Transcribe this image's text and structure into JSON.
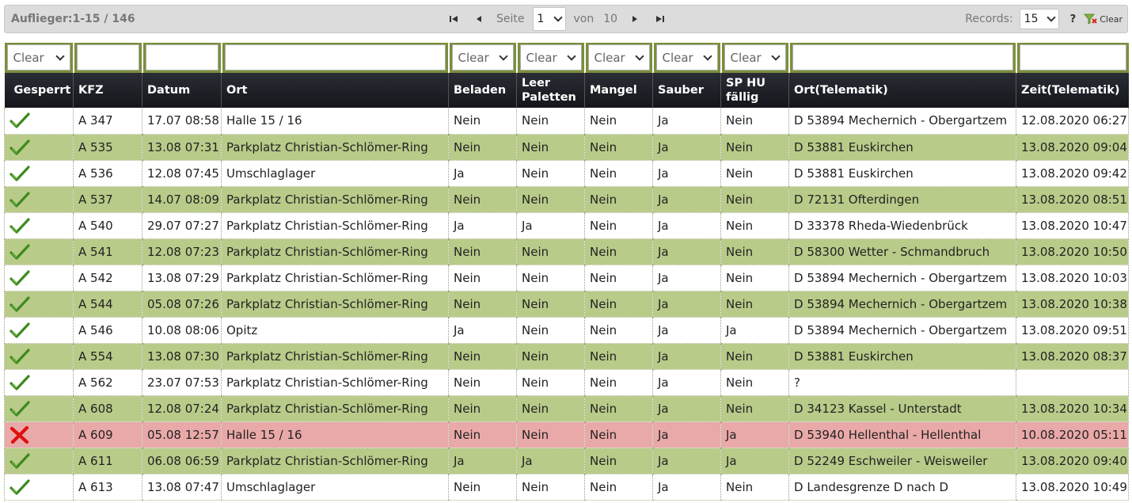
{
  "toolbar": {
    "title": "Auflieger:1-15 / 146",
    "page_label": "Seite",
    "page_value": "1",
    "of_label": "von",
    "total_pages": "10",
    "records_label": "Records:",
    "records_value": "15",
    "help_label": "?",
    "clear_label": "Clear"
  },
  "filters": [
    {
      "type": "select",
      "value": "Clear"
    },
    {
      "type": "input",
      "value": ""
    },
    {
      "type": "input",
      "value": ""
    },
    {
      "type": "input",
      "value": ""
    },
    {
      "type": "select",
      "value": "Clear"
    },
    {
      "type": "select",
      "value": "Clear"
    },
    {
      "type": "select",
      "value": "Clear"
    },
    {
      "type": "select",
      "value": "Clear"
    },
    {
      "type": "select",
      "value": "Clear"
    },
    {
      "type": "input",
      "value": ""
    },
    {
      "type": "input",
      "value": ""
    }
  ],
  "columns": [
    "Gesperrt",
    "KFZ",
    "Datum",
    "Ort",
    "Beladen",
    "Leer Paletten",
    "Mangel",
    "Sauber",
    "SP HU fällig",
    "Ort(Telematik)",
    "Zeit(Telematik)"
  ],
  "rows": [
    {
      "status": "ok",
      "cells": [
        "A 347",
        "17.07 08:58",
        "Halle 15 / 16",
        "Nein",
        "Nein",
        "Nein",
        "Ja",
        "Nein",
        "D 53894 Mechernich - Obergartzem",
        "12.08.2020 06:27"
      ]
    },
    {
      "status": "ok",
      "cells": [
        "A 535",
        "13.08 07:31",
        "Parkplatz Christian-Schlömer-Ring",
        "Nein",
        "Nein",
        "Nein",
        "Ja",
        "Nein",
        "D 53881 Euskirchen",
        "13.08.2020 09:04"
      ]
    },
    {
      "status": "ok",
      "cells": [
        "A 536",
        "12.08 07:45",
        "Umschlaglager",
        "Ja",
        "Nein",
        "Nein",
        "Ja",
        "Nein",
        "D 53881 Euskirchen",
        "13.08.2020 09:42"
      ]
    },
    {
      "status": "ok",
      "cells": [
        "A 537",
        "14.07 08:09",
        "Parkplatz Christian-Schlömer-Ring",
        "Nein",
        "Nein",
        "Nein",
        "Ja",
        "Nein",
        "D 72131 Ofterdingen",
        "13.08.2020 08:51"
      ]
    },
    {
      "status": "ok",
      "cells": [
        "A 540",
        "29.07 07:27",
        "Parkplatz Christian-Schlömer-Ring",
        "Ja",
        "Ja",
        "Nein",
        "Ja",
        "Nein",
        "D 33378 Rheda-Wiedenbrück",
        "13.08.2020 10:47"
      ]
    },
    {
      "status": "ok",
      "cells": [
        "A 541",
        "12.08 07:23",
        "Parkplatz Christian-Schlömer-Ring",
        "Nein",
        "Nein",
        "Nein",
        "Ja",
        "Nein",
        "D 58300 Wetter - Schmandbruch",
        "13.08.2020 10:50"
      ]
    },
    {
      "status": "ok",
      "cells": [
        "A 542",
        "13.08 07:29",
        "Parkplatz Christian-Schlömer-Ring",
        "Nein",
        "Nein",
        "Nein",
        "Ja",
        "Nein",
        "D 53894 Mechernich - Obergartzem",
        "13.08.2020 10:03"
      ]
    },
    {
      "status": "ok",
      "cells": [
        "A 544",
        "05.08 07:26",
        "Parkplatz Christian-Schlömer-Ring",
        "Nein",
        "Nein",
        "Nein",
        "Ja",
        "Nein",
        "D 53894 Mechernich - Obergartzem",
        "13.08.2020 10:38"
      ]
    },
    {
      "status": "ok",
      "cells": [
        "A 546",
        "10.08 08:06",
        "Opitz",
        "Ja",
        "Nein",
        "Nein",
        "Ja",
        "Ja",
        "D 53894 Mechernich - Obergartzem",
        "13.08.2020 09:51"
      ]
    },
    {
      "status": "ok",
      "cells": [
        "A 554",
        "13.08 07:30",
        "Parkplatz Christian-Schlömer-Ring",
        "Nein",
        "Nein",
        "Nein",
        "Ja",
        "Nein",
        "D 53881 Euskirchen",
        "13.08.2020 08:37"
      ]
    },
    {
      "status": "ok",
      "cells": [
        "A 562",
        "23.07 07:53",
        "Parkplatz Christian-Schlömer-Ring",
        "Nein",
        "Nein",
        "Nein",
        "Ja",
        "Nein",
        "?",
        ""
      ]
    },
    {
      "status": "ok",
      "cells": [
        "A 608",
        "12.08 07:24",
        "Parkplatz Christian-Schlömer-Ring",
        "Nein",
        "Nein",
        "Nein",
        "Ja",
        "Nein",
        "D 34123 Kassel - Unterstadt",
        "13.08.2020 10:34"
      ]
    },
    {
      "status": "blocked",
      "cells": [
        "A 609",
        "05.08 12:57",
        "Halle 15 / 16",
        "Nein",
        "Nein",
        "Nein",
        "Ja",
        "Ja",
        "D 53940 Hellenthal - Hellenthal",
        "10.08.2020 05:11"
      ]
    },
    {
      "status": "ok",
      "cells": [
        "A 611",
        "06.08 06:59",
        "Parkplatz Christian-Schlömer-Ring",
        "Ja",
        "Ja",
        "Nein",
        "Ja",
        "Ja",
        "D 52249 Eschweiler - Weisweiler",
        "13.08.2020 09:40"
      ]
    },
    {
      "status": "ok",
      "cells": [
        "A 613",
        "13.08 07:47",
        "Umschlaglager",
        "Nein",
        "Nein",
        "Nein",
        "Ja",
        "Nein",
        "D Landesgrenze D nach D",
        "13.08.2020 10:49"
      ]
    }
  ],
  "colors": {
    "row_alt": "#b9cb89",
    "row_blocked": "#e9a9a8",
    "filter_bar": "#7a8f3a",
    "header": "#1e2026",
    "check": "#3c8a1e",
    "cross": "#e01010"
  }
}
